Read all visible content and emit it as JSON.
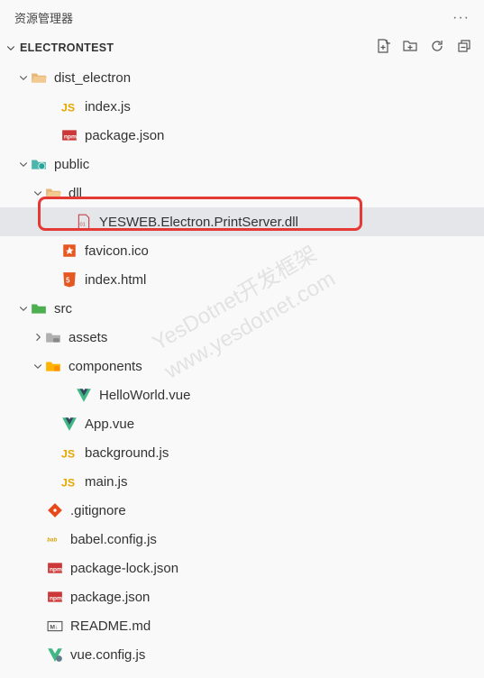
{
  "title": "资源管理器",
  "project": "ELECTRONTEST",
  "watermark_1": "YesDotnet开发框架",
  "watermark_2": "www.yesdotnet.com",
  "tree": {
    "dist_electron": {
      "label": "dist_electron",
      "index_js": "index.js",
      "package_json": "package.json"
    },
    "public": {
      "label": "public",
      "dll": {
        "label": "dll",
        "printserver": "YESWEB.Electron.PrintServer.dll"
      },
      "favicon": "favicon.ico",
      "index_html": "index.html"
    },
    "src": {
      "label": "src",
      "assets": "assets",
      "components": {
        "label": "components",
        "helloworld": "HelloWorld.vue"
      },
      "app_vue": "App.vue",
      "background_js": "background.js",
      "main_js": "main.js"
    },
    "gitignore": ".gitignore",
    "babel_config": "babel.config.js",
    "package_lock": "package-lock.json",
    "package_json": "package.json",
    "readme": "README.md",
    "vue_config": "vue.config.js"
  }
}
